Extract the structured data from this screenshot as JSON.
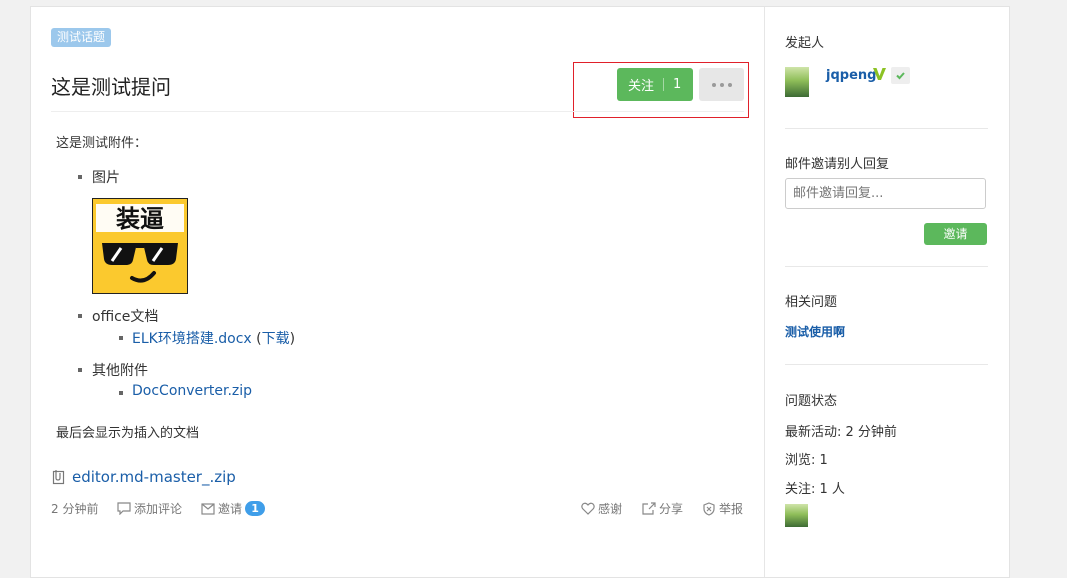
{
  "question": {
    "topic_tag": "测试话题",
    "title": "这是测试提问",
    "follow_label": "关注",
    "follow_count": "1",
    "intro": "这是测试附件：",
    "list": [
      {
        "label": "图片"
      },
      {
        "label": "office文档",
        "sub": {
          "link": "ELK环境搭建.docx",
          "download": "下载"
        }
      },
      {
        "label": "其他附件",
        "sub": {
          "link": "DocConverter.zip"
        }
      }
    ],
    "image_text": "装逼",
    "closing_text": "最后会显示为插入的文档",
    "attachment": "editor.md-master_.zip",
    "meta": {
      "time": "2 分钟前",
      "add_comment": "添加评论",
      "invite": "邀请",
      "invite_count": "1",
      "thanks": "感谢",
      "share": "分享",
      "report": "举报"
    }
  },
  "sidebar": {
    "initiator_title": "发起人",
    "user_name": "jqpeng",
    "invite_title": "邮件邀请别人回复",
    "invite_placeholder": "邮件邀请回复...",
    "invite_button": "邀请",
    "related_title": "相关问题",
    "related_link": "测试使用啊",
    "status_title": "问题状态",
    "status": {
      "latest_label": "最新活动:",
      "latest_value": "2 分钟前",
      "views_label": "浏览:",
      "views_value": "1",
      "follow_label": "关注:",
      "follow_value": "1 人"
    }
  },
  "colors": {
    "accent_green": "#5cb85c",
    "link_blue": "#1a5ea8",
    "tag_blue": "#9cc8ec",
    "highlight_red": "#e0202a",
    "badge_blue": "#3f9ee9"
  }
}
